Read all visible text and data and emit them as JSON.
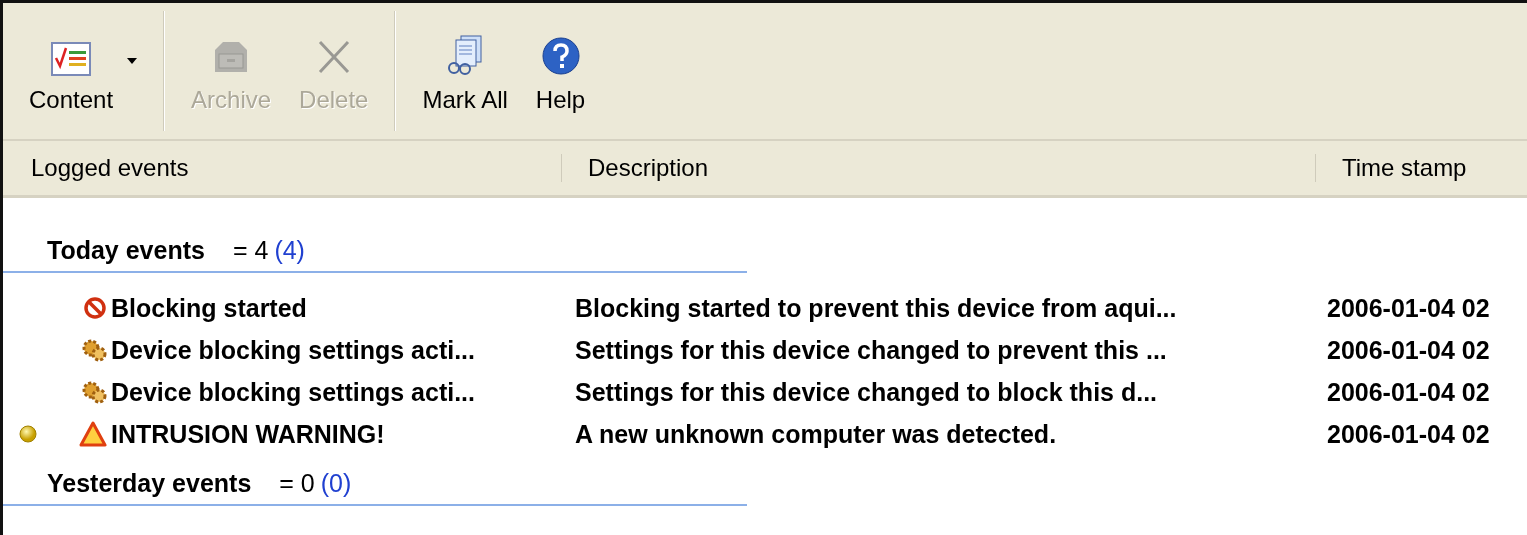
{
  "toolbar": [
    {
      "label": "Content",
      "kind": "content",
      "disabled": false,
      "dropdown": true
    },
    {
      "label": "Archive",
      "kind": "archive",
      "disabled": true,
      "dropdown": false
    },
    {
      "label": "Delete",
      "kind": "delete",
      "disabled": true,
      "dropdown": false
    },
    {
      "label": "Mark All",
      "kind": "markall",
      "disabled": false,
      "dropdown": false
    },
    {
      "label": "Help",
      "kind": "help",
      "disabled": false,
      "dropdown": false
    }
  ],
  "columns": [
    "Logged events",
    "Description",
    "Time stamp"
  ],
  "groups": [
    {
      "title": "Today events",
      "count": "= 4",
      "unread": "(4)",
      "rows": [
        {
          "kind": "block",
          "unread": false,
          "event": "Blocking started",
          "description": "Blocking started to prevent this device from aqui...",
          "time": "2006-01-04 02"
        },
        {
          "kind": "gear",
          "unread": false,
          "event": "Device blocking settings acti...",
          "description": "Settings for this device changed to prevent this ...",
          "time": "2006-01-04 02"
        },
        {
          "kind": "gear",
          "unread": false,
          "event": "Device blocking settings acti...",
          "description": "Settings for this device changed to block this d...",
          "time": "2006-01-04 02"
        },
        {
          "kind": "warning",
          "unread": true,
          "event": "INTRUSION WARNING!",
          "description": "A new unknown computer was detected.",
          "time": "2006-01-04 02"
        }
      ]
    },
    {
      "title": "Yesterday events",
      "count": "= 0",
      "unread": "(0)"
    }
  ]
}
